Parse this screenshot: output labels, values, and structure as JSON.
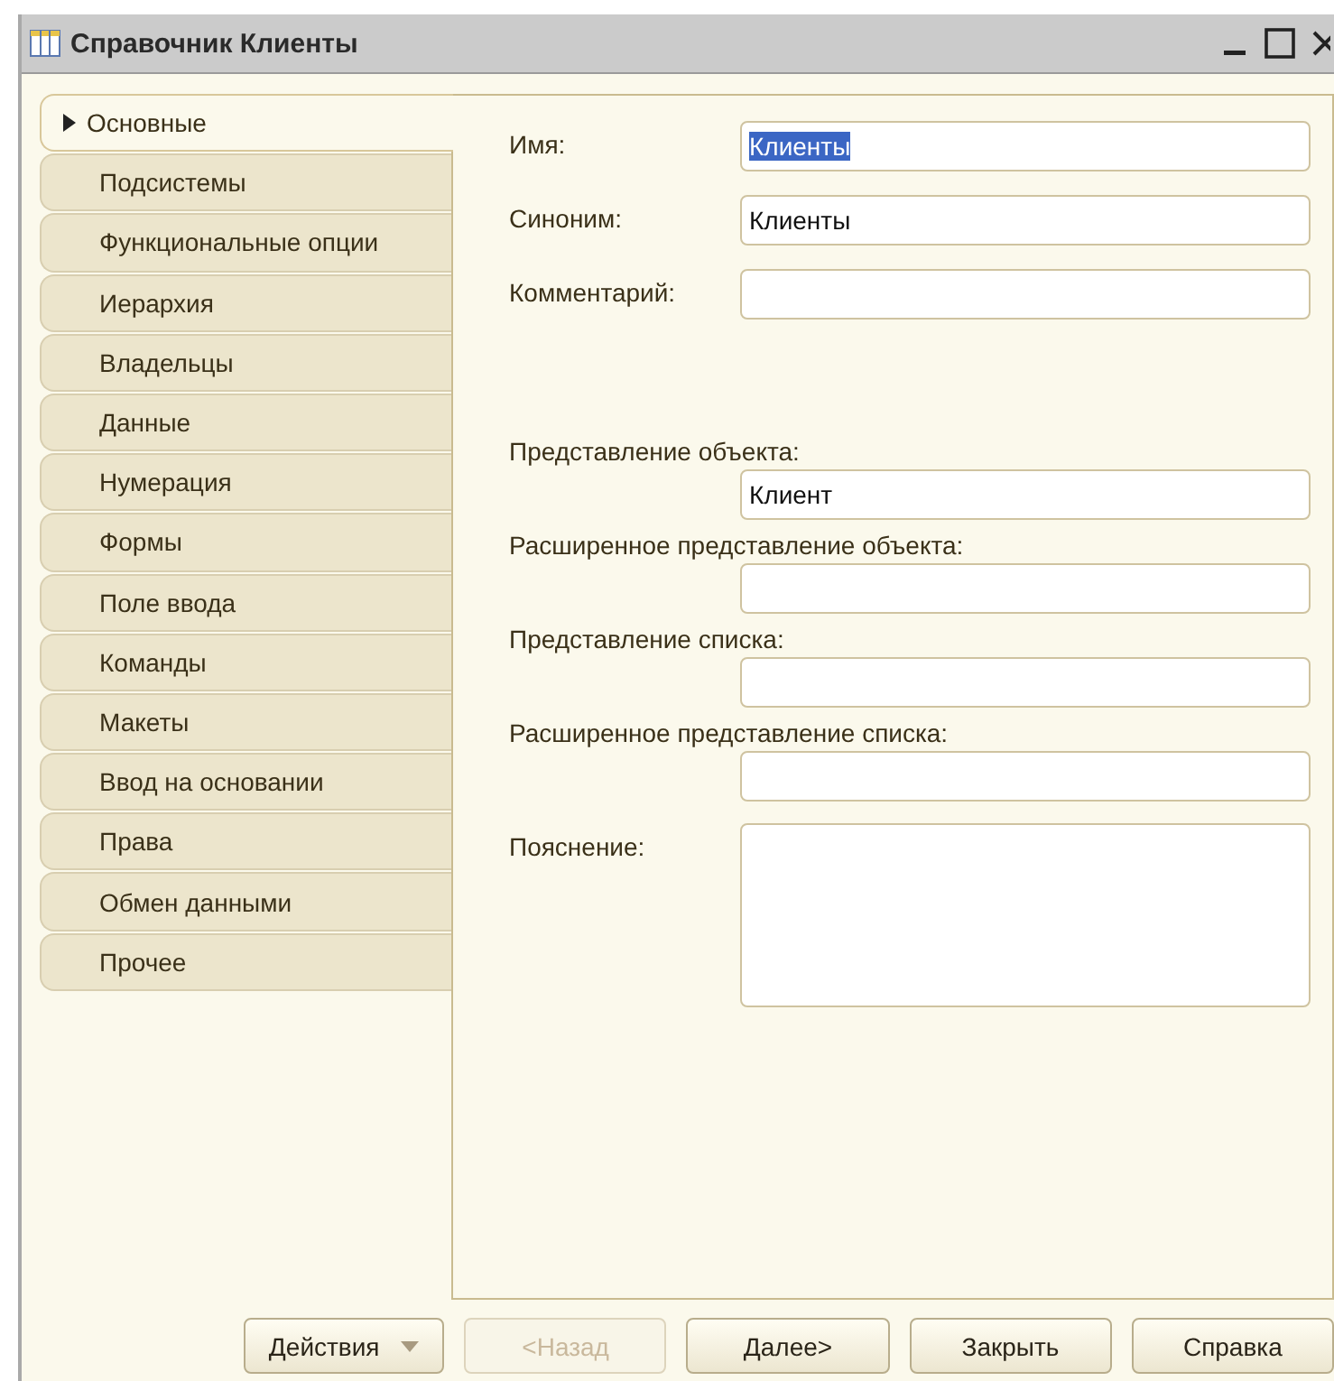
{
  "window": {
    "title": "Справочник Клиенты"
  },
  "tabs": [
    {
      "label": "Основные",
      "selected": true
    },
    {
      "label": "Подсистемы",
      "selected": false
    },
    {
      "label": "Функциональные опции",
      "selected": false
    },
    {
      "label": "Иерархия",
      "selected": false
    },
    {
      "label": "Владельцы",
      "selected": false
    },
    {
      "label": "Данные",
      "selected": false
    },
    {
      "label": "Нумерация",
      "selected": false
    },
    {
      "label": "Формы",
      "selected": false
    },
    {
      "label": "Поле ввода",
      "selected": false
    },
    {
      "label": "Команды",
      "selected": false
    },
    {
      "label": "Макеты",
      "selected": false
    },
    {
      "label": "Ввод на основании",
      "selected": false
    },
    {
      "label": "Права",
      "selected": false
    },
    {
      "label": "Обмен данными",
      "selected": false
    },
    {
      "label": "Прочее",
      "selected": false
    }
  ],
  "fields": [
    {
      "kind": "inline",
      "label": "Имя:",
      "value": "Клиенты",
      "highlighted": true
    },
    {
      "kind": "inline",
      "label": "Синоним:",
      "value": "Клиенты"
    },
    {
      "kind": "inline",
      "label": "Комментарий:"
    },
    {
      "kind": "stacked",
      "label": "Представление объекта:",
      "value": "Клиент"
    },
    {
      "kind": "stacked",
      "label": "Расширенное представление объекта:"
    },
    {
      "kind": "stacked",
      "label": "Представление списка:"
    },
    {
      "kind": "stacked",
      "label": "Расширенное представление списка:"
    },
    {
      "kind": "memo",
      "label": "Пояснение:"
    }
  ],
  "buttons": [
    {
      "label": "Действия",
      "kind": "dropdown",
      "disabled": false
    },
    {
      "label": "<Назад",
      "kind": "plain",
      "disabled": true
    },
    {
      "label": "Далее>",
      "kind": "plain",
      "disabled": false
    },
    {
      "label": "Закрыть",
      "kind": "plain",
      "disabled": false
    },
    {
      "label": "Справка",
      "kind": "plain",
      "disabled": false
    }
  ]
}
